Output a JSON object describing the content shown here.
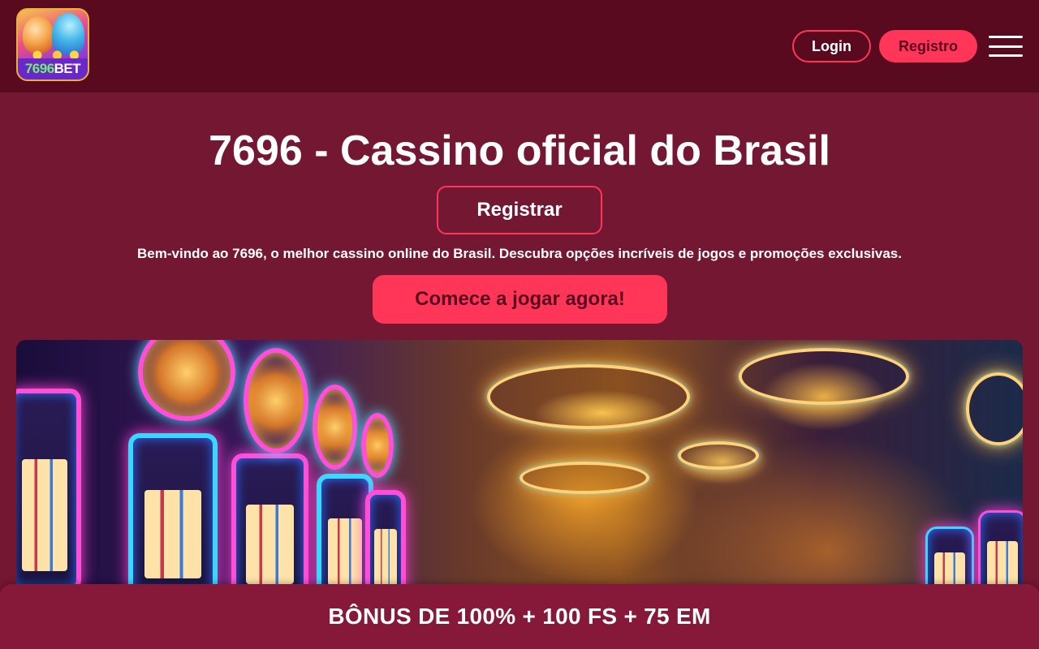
{
  "header": {
    "logo_text_number": "7696",
    "logo_text_brand": "BET",
    "login_label": "Login",
    "register_label": "Registro",
    "menu_icon": "hamburger-menu-icon"
  },
  "hero": {
    "title": "7696 - Cassino oficial do Brasil",
    "register_button_label": "Registrar",
    "welcome_text": "Bem-vindo ao 7696, o melhor cassino online do Brasil. Descubra opções incríveis de jogos e promoções exclusivas.",
    "cta_label": "Comece a jogar agora!"
  },
  "banner": {
    "image_subject": "neon casino interior with slot machines and golden chandeliers"
  },
  "bonus": {
    "text": "BÔNUS DE 100% + 100 FS + 75 EM"
  },
  "colors": {
    "header_bg": "#5a0a1f",
    "page_bg": "#741733",
    "accent": "#ff3657",
    "bonus_bar_bg": "#86193a",
    "text": "#ffffff"
  }
}
